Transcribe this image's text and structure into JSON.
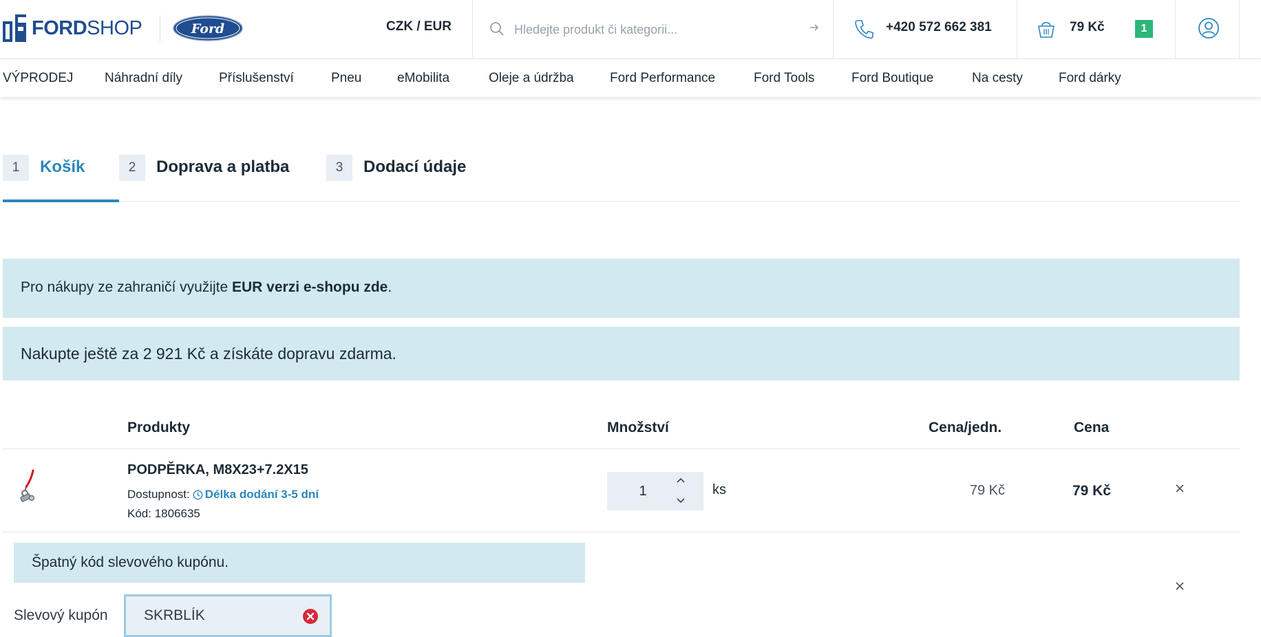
{
  "header": {
    "logo_bold": "FORD",
    "logo_light": "SHOP",
    "brand_badge": "Ford",
    "currency": "CZK / EUR",
    "search_placeholder": "Hledejte produkt či kategorii...",
    "phone": "+420 572 662 381",
    "cart_total": "79 Kč",
    "cart_count": "1"
  },
  "nav": {
    "items": [
      "VÝPRODEJ",
      "Náhradní díly",
      "Příslušenství",
      "Pneu",
      "eMobilita",
      "Oleje a údržba",
      "Ford Performance",
      "Ford Tools",
      "Ford Boutique",
      "Na cesty",
      "Ford dárky"
    ]
  },
  "steps": [
    {
      "num": "1",
      "label": "Košík",
      "active": true
    },
    {
      "num": "2",
      "label": "Doprava a platba",
      "active": false
    },
    {
      "num": "3",
      "label": "Dodací údaje",
      "active": false
    }
  ],
  "info": {
    "foreign_prefix": "Pro nákupy ze zahraničí využijte ",
    "foreign_link": "EUR verzi e-shopu zde",
    "foreign_suffix": ".",
    "free_shipping": "Nakupte ještě za 2 921 Kč a získáte dopravu zdarma."
  },
  "table": {
    "headers": {
      "products": "Produkty",
      "quantity": "Množství",
      "unit_price": "Cena/jedn.",
      "price": "Cena"
    },
    "rows": [
      {
        "name": "PODPĚRKA, M8X23+7.2X15",
        "availability_label": "Dostupnost:",
        "availability_value": "Délka dodání 3-5 dní",
        "code": "Kód: 1806635",
        "quantity": "1",
        "unit": "ks",
        "unit_price": "79 Kč",
        "price": "79 Kč"
      }
    ]
  },
  "coupon": {
    "error": "Špatný kód slevového kupónu.",
    "label": "Slevový kupón",
    "value": "SKRBLÍK"
  },
  "colors": {
    "brand_blue": "#1f4d8f",
    "accent_blue": "#2c86be",
    "info_bg": "#d2e9ef",
    "cart_badge": "#2cb67a",
    "error_red": "#d6293b"
  }
}
